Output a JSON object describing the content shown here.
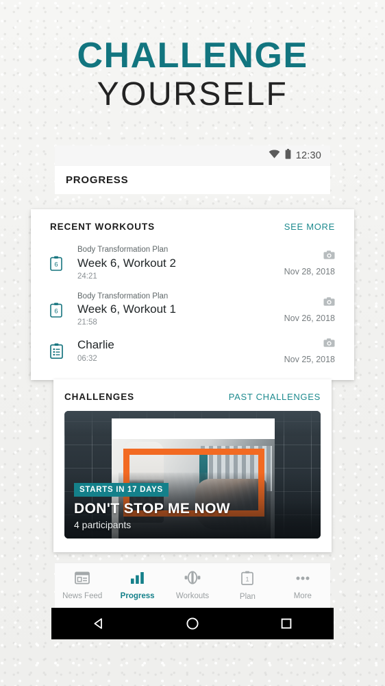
{
  "headline": {
    "line1": "CHALLENGE",
    "line2": "YOURSELF",
    "color_primary": "#12757f",
    "color_secondary": "#232323"
  },
  "status_bar": {
    "time": "12:30",
    "wifi_icon": "wifi-icon",
    "battery_icon": "battery-icon"
  },
  "appbar": {
    "title": "PROGRESS"
  },
  "recent_workouts": {
    "title": "RECENT WORKOUTS",
    "action_label": "SEE MORE",
    "action_color": "#1d8a8e",
    "items": [
      {
        "icon": "clipboard-week-icon",
        "icon_badge": "6",
        "subtitle": "Body Transformation Plan",
        "name": "Week 6, Workout 2",
        "duration": "24:21",
        "date": "Nov 28, 2018",
        "photo_icon": "camera-icon"
      },
      {
        "icon": "clipboard-week-icon",
        "icon_badge": "6",
        "subtitle": "Body Transformation Plan",
        "name": "Week 6, Workout 1",
        "duration": "21:58",
        "date": "Nov 26, 2018",
        "photo_icon": "camera-icon"
      },
      {
        "icon": "clipboard-list-icon",
        "icon_badge": "",
        "subtitle": "",
        "name": "Charlie",
        "duration": "06:32",
        "date": "Nov 25, 2018",
        "photo_icon": "camera-icon"
      }
    ]
  },
  "challenges": {
    "title": "CHALLENGES",
    "action_label": "PAST CHALLENGES",
    "action_color": "#1d8a8e",
    "banner": {
      "badge": "STARTS IN 17 DAYS",
      "badge_color": "#14808a",
      "title": "DON'T STOP ME NOW",
      "participants": "4 participants",
      "accent_color": "#f26a22"
    }
  },
  "bottom_nav": {
    "active_color": "#14808a",
    "inactive_color": "#9a9fa1",
    "items": [
      {
        "label": "News Feed",
        "icon": "news-feed-icon",
        "active": false
      },
      {
        "label": "Progress",
        "icon": "bar-chart-icon",
        "active": true
      },
      {
        "label": "Workouts",
        "icon": "dumbbell-icon",
        "active": false
      },
      {
        "label": "Plan",
        "icon": "calendar-icon",
        "active": false
      },
      {
        "label": "More",
        "icon": "more-dots-icon",
        "active": false
      }
    ]
  },
  "android_nav": {
    "back": "back-triangle-icon",
    "home": "home-circle-icon",
    "recents": "recents-square-icon"
  }
}
